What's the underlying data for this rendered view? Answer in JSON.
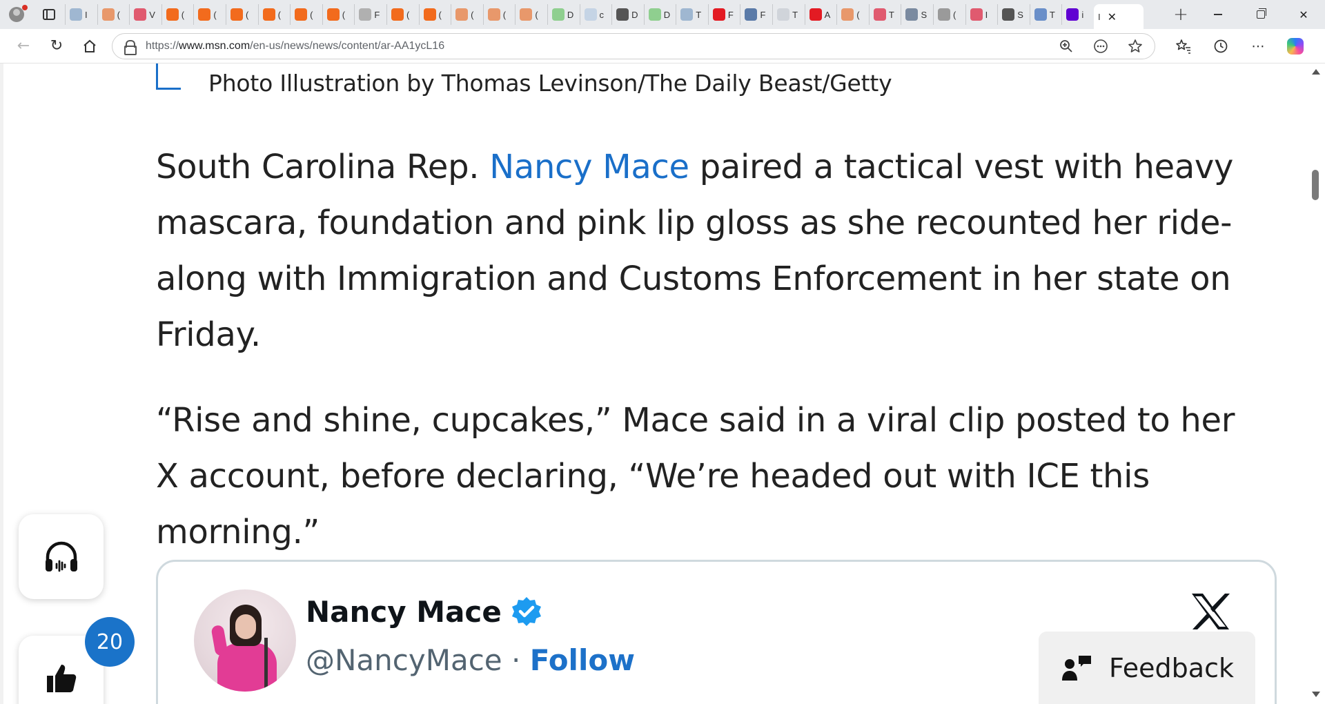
{
  "browser": {
    "tabs": [
      {
        "icon": "web-icon",
        "color": "#9fb7d1",
        "letter": "I"
      },
      {
        "icon": "bookmark-icon",
        "color": "#e8986b",
        "letter": "("
      },
      {
        "icon": "youtube-icon",
        "color": "#e05a6f",
        "letter": "V"
      },
      {
        "icon": "bookmark-icon",
        "color": "#f26b1d",
        "letter": "("
      },
      {
        "icon": "bookmark-icon",
        "color": "#f26b1d",
        "letter": "("
      },
      {
        "icon": "bookmark-icon",
        "color": "#f26b1d",
        "letter": "("
      },
      {
        "icon": "bookmark-icon",
        "color": "#f26b1d",
        "letter": "("
      },
      {
        "icon": "bookmark-icon",
        "color": "#f26b1d",
        "letter": "("
      },
      {
        "icon": "bookmark-icon",
        "color": "#f26b1d",
        "letter": "("
      },
      {
        "icon": "page-icon",
        "color": "#b0b0b0",
        "letter": "F"
      },
      {
        "icon": "bookmark-icon",
        "color": "#f26b1d",
        "letter": "("
      },
      {
        "icon": "bookmark-icon",
        "color": "#f26b1d",
        "letter": "("
      },
      {
        "icon": "bookmark-icon",
        "color": "#e8986b",
        "letter": "("
      },
      {
        "icon": "bookmark-icon",
        "color": "#e8986b",
        "letter": "("
      },
      {
        "icon": "bookmark-icon",
        "color": "#e8986b",
        "letter": "("
      },
      {
        "icon": "play-icon",
        "color": "#8fcf8f",
        "letter": "D"
      },
      {
        "icon": "search-icon",
        "color": "#c5d4e5",
        "letter": "c"
      },
      {
        "icon": "stripe-icon",
        "color": "#555555",
        "letter": "D"
      },
      {
        "icon": "play-icon",
        "color": "#8fcf8f",
        "letter": "D"
      },
      {
        "icon": "web-icon",
        "color": "#9fb7d1",
        "letter": "T"
      },
      {
        "icon": "youtube-icon",
        "color": "#e31b23",
        "letter": "F"
      },
      {
        "icon": "news-icon",
        "color": "#5a7aa8",
        "letter": "F"
      },
      {
        "icon": "gp-icon",
        "color": "#d0d4da",
        "letter": "T"
      },
      {
        "icon": "youtube-icon",
        "color": "#e31b23",
        "letter": "A"
      },
      {
        "icon": "bookmark-icon",
        "color": "#e8986b",
        "letter": "("
      },
      {
        "icon": "youtube-icon",
        "color": "#e05a6f",
        "letter": "T"
      },
      {
        "icon": "chart-icon",
        "color": "#7a8aa0",
        "letter": "S"
      },
      {
        "icon": "scale-icon",
        "color": "#9a9a9a",
        "letter": "("
      },
      {
        "icon": "youtube-icon",
        "color": "#e05a6f",
        "letter": "I"
      },
      {
        "icon": "pause-icon",
        "color": "#555555",
        "letter": "S"
      },
      {
        "icon": "y-icon",
        "color": "#6a8fc9",
        "letter": "T"
      },
      {
        "icon": "yahoo-icon",
        "color": "#6001d2",
        "letter": "i"
      }
    ],
    "active_tab": {
      "letter": "I",
      "close": "✕"
    },
    "new_tab": "+",
    "url_prefix": "https://",
    "url_host": "www.msn.com",
    "url_path": "/en-us/news/news/content/ar-AA1ycL16"
  },
  "article": {
    "caption": "Photo Illustration by Thomas Levinson/The Daily Beast/Getty",
    "p1_before": "South Carolina Rep. ",
    "p1_link": "Nancy Mace",
    "p1_after": " paired a tactical vest with heavy mascara, foundation and pink lip gloss as she recounted her ride-along with Immigration and Customs Enforcement in her state on Friday.",
    "p2": "“Rise and shine, cupcakes,” Mace said in a viral clip posted to her X account, before declaring, “We’re headed out with ICE this morning.”",
    "link_color": "#1a6fc9"
  },
  "widgets": {
    "like_count": "20",
    "feedback_label": "Feedback"
  },
  "tweet": {
    "name": "Nancy Mace",
    "handle": "@NancyMace",
    "separator": " · ",
    "follow": "Follow",
    "verified_color": "#1d9bf0"
  }
}
